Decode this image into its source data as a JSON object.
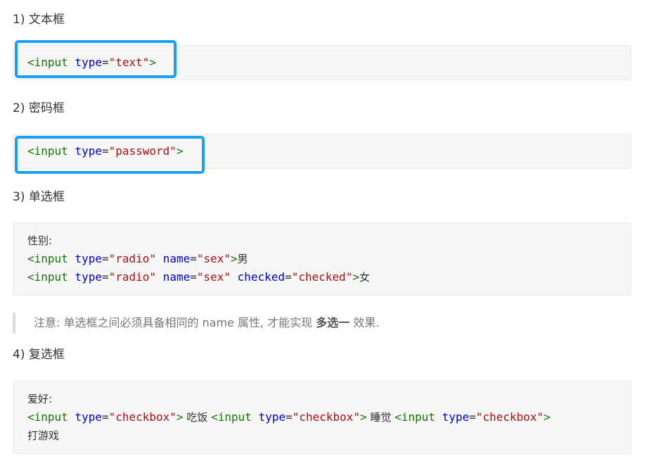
{
  "sections": [
    {
      "heading": "1) 文本框",
      "lines": [
        [
          {
            "t": "tag",
            "v": "<input"
          },
          {
            "t": "sp",
            "v": " "
          },
          {
            "t": "attr",
            "v": "type"
          },
          {
            "t": "eq",
            "v": "="
          },
          {
            "t": "str",
            "v": "\"text\""
          },
          {
            "t": "tag",
            "v": ">"
          }
        ]
      ]
    },
    {
      "heading": "2) 密码框",
      "lines": [
        [
          {
            "t": "tag",
            "v": "<input"
          },
          {
            "t": "sp",
            "v": " "
          },
          {
            "t": "attr",
            "v": "type"
          },
          {
            "t": "eq",
            "v": "="
          },
          {
            "t": "str",
            "v": "\"password\""
          },
          {
            "t": "tag",
            "v": ">"
          }
        ]
      ]
    },
    {
      "heading": "3) 单选框",
      "lines": [
        [
          {
            "t": "txt",
            "v": "性别:"
          }
        ],
        [
          {
            "t": "tag",
            "v": "<input"
          },
          {
            "t": "sp",
            "v": " "
          },
          {
            "t": "attr",
            "v": "type"
          },
          {
            "t": "eq",
            "v": "="
          },
          {
            "t": "str",
            "v": "\"radio\""
          },
          {
            "t": "sp",
            "v": " "
          },
          {
            "t": "attr",
            "v": "name"
          },
          {
            "t": "eq",
            "v": "="
          },
          {
            "t": "str",
            "v": "\"sex\""
          },
          {
            "t": "tag",
            "v": ">"
          },
          {
            "t": "txt",
            "v": "男"
          }
        ],
        [
          {
            "t": "tag",
            "v": "<input"
          },
          {
            "t": "sp",
            "v": " "
          },
          {
            "t": "attr",
            "v": "type"
          },
          {
            "t": "eq",
            "v": "="
          },
          {
            "t": "str",
            "v": "\"radio\""
          },
          {
            "t": "sp",
            "v": " "
          },
          {
            "t": "attr",
            "v": "name"
          },
          {
            "t": "eq",
            "v": "="
          },
          {
            "t": "str",
            "v": "\"sex\""
          },
          {
            "t": "sp",
            "v": " "
          },
          {
            "t": "attr",
            "v": "checked"
          },
          {
            "t": "eq",
            "v": "="
          },
          {
            "t": "str",
            "v": "\"checked\""
          },
          {
            "t": "tag",
            "v": ">"
          },
          {
            "t": "txt",
            "v": "女"
          }
        ]
      ]
    },
    {
      "heading": "4) 复选框",
      "lines": [
        [
          {
            "t": "txt",
            "v": "爱好:"
          }
        ],
        [
          {
            "t": "tag",
            "v": "<input"
          },
          {
            "t": "sp",
            "v": " "
          },
          {
            "t": "attr",
            "v": "type"
          },
          {
            "t": "eq",
            "v": "="
          },
          {
            "t": "str",
            "v": "\"checkbox\""
          },
          {
            "t": "tag",
            "v": ">"
          },
          {
            "t": "txt",
            "v": " 吃饭 "
          },
          {
            "t": "tag",
            "v": "<input"
          },
          {
            "t": "sp",
            "v": " "
          },
          {
            "t": "attr",
            "v": "type"
          },
          {
            "t": "eq",
            "v": "="
          },
          {
            "t": "str",
            "v": "\"checkbox\""
          },
          {
            "t": "tag",
            "v": ">"
          },
          {
            "t": "txt",
            "v": " 睡觉 "
          },
          {
            "t": "tag",
            "v": "<input"
          },
          {
            "t": "sp",
            "v": " "
          },
          {
            "t": "attr",
            "v": "type"
          },
          {
            "t": "eq",
            "v": "="
          },
          {
            "t": "str",
            "v": "\"checkbox\""
          },
          {
            "t": "tag",
            "v": ">"
          }
        ],
        [
          {
            "t": "txt",
            "v": "打游戏"
          }
        ]
      ]
    }
  ],
  "note": {
    "prefix": "注意: 单选框之间必须具备相同的 name 属性, 才能实现 ",
    "strong": "多选一",
    "suffix": " 效果."
  },
  "colors": {
    "highlight": "#1ba1f2",
    "tag": "#117700",
    "attr": "#0000cc",
    "string": "#aa1111"
  }
}
